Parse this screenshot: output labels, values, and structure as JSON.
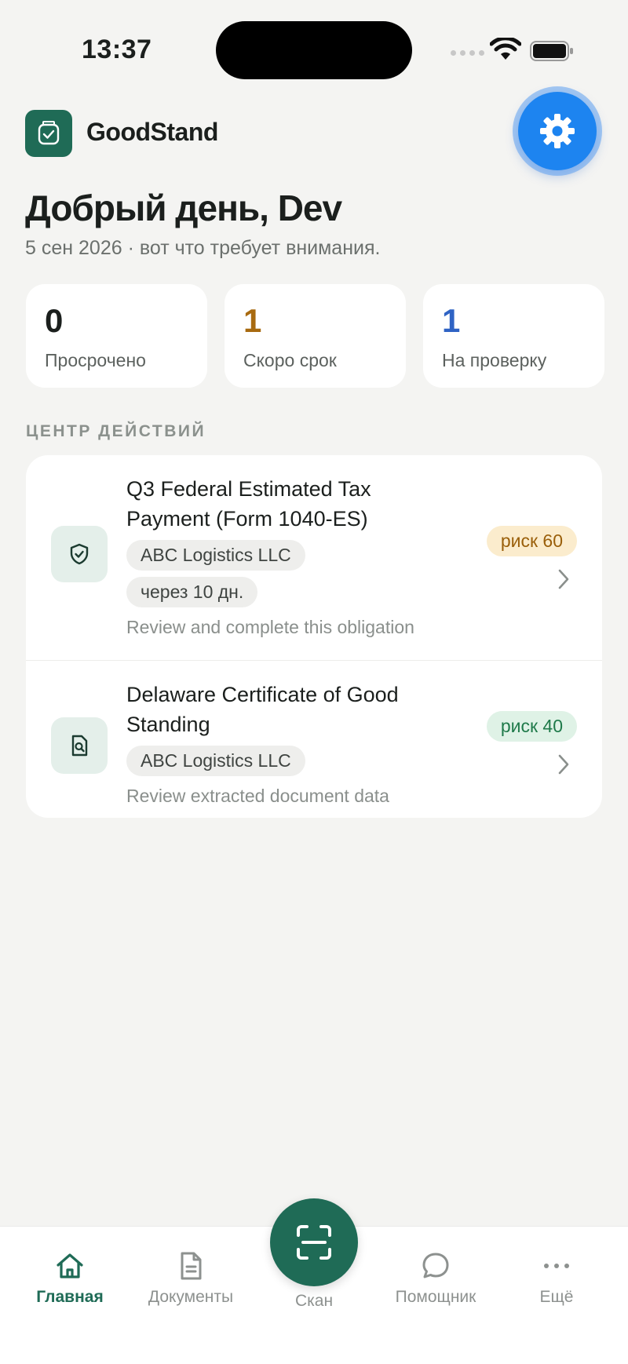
{
  "status_bar": {
    "time": "13:37"
  },
  "header": {
    "brand": "GoodStand",
    "greeting": "Добрый день, Dev",
    "subtitle": "5 сен 2026 · вот что требует внимания."
  },
  "stats": [
    {
      "value": "0",
      "label": "Просрочено"
    },
    {
      "value": "1",
      "label": "Скоро срок"
    },
    {
      "value": "1",
      "label": "На проверку"
    }
  ],
  "section_label": "ЦЕНТР ДЕЙСТВИЙ",
  "actions": [
    {
      "title": "Q3 Federal Estimated Tax Payment (Form 1040-ES)",
      "entity": "ABC Logistics LLC",
      "due": "через 10 дн.",
      "description": "Review and complete this obligation",
      "risk": "риск 60"
    },
    {
      "title": "Delaware Certificate of Good Standing",
      "entity": "ABC Logistics LLC",
      "description": "Review extracted document data",
      "risk": "риск 40"
    }
  ],
  "tabs": {
    "home": "Главная",
    "documents": "Документы",
    "scan": "Скан",
    "assistant": "Помощник",
    "more": "Ещё"
  },
  "colors": {
    "brand": "#1f6b56",
    "accent_blue": "#1d84f0",
    "risk_amber": "#9a5f0a",
    "risk_green": "#1f7a4a"
  }
}
